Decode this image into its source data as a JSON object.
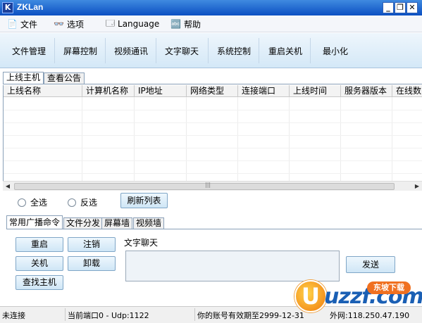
{
  "window": {
    "title": "ZKLan",
    "icon_letter": "K",
    "minimize": "_",
    "restore": "❐",
    "close": "✕"
  },
  "menu": [
    {
      "label": "文件",
      "icon": "document-icon",
      "glyph": "📄"
    },
    {
      "label": "选项",
      "icon": "glasses-icon",
      "glyph": "👓"
    },
    {
      "label": "Language",
      "icon": "language-icon",
      "glyph": "🗔"
    },
    {
      "label": "帮助",
      "icon": "help-icon",
      "glyph": "🔤"
    }
  ],
  "toolbar": [
    "文件管理",
    "屏幕控制",
    "视频通讯",
    "文字聊天",
    "系统控制",
    "重启关机",
    "最小化"
  ],
  "upper_tabs": [
    "上线主机",
    "查看公告"
  ],
  "columns": [
    "上线名称",
    "计算机名称",
    "IP地址",
    "网络类型",
    "连接端口",
    "上线时间",
    "服务器版本",
    "在线数"
  ],
  "scroll_grip": "|||",
  "selection": {
    "select_all": "全选",
    "invert": "反选",
    "refresh": "刷新列表"
  },
  "lower_tabs": [
    "常用广播命令",
    "文件分发",
    "屏幕墙",
    "视频墙"
  ],
  "commands": {
    "restart": "重启",
    "logoff": "注销",
    "shutdown": "关机",
    "uninstall": "卸载",
    "find_host": "查找主机"
  },
  "chat": {
    "label": "文字聊天",
    "message": "",
    "send": "发送"
  },
  "status": {
    "connection": "未连接",
    "port": "当前端口0 - Udp:1122",
    "account": "你的账号有效期至2999-12-31",
    "wan": "外网:118.250.47.190"
  },
  "watermark": {
    "letter": "U",
    "text": "uzzf.com",
    "badge": "东坡下载"
  },
  "colors": {
    "titlebar": "#0b4fc2",
    "toolbar": "#d4e8f7",
    "button": "#cfe6f6",
    "watermark_blue": "#1a5fb4",
    "watermark_orange": "#f07020"
  }
}
